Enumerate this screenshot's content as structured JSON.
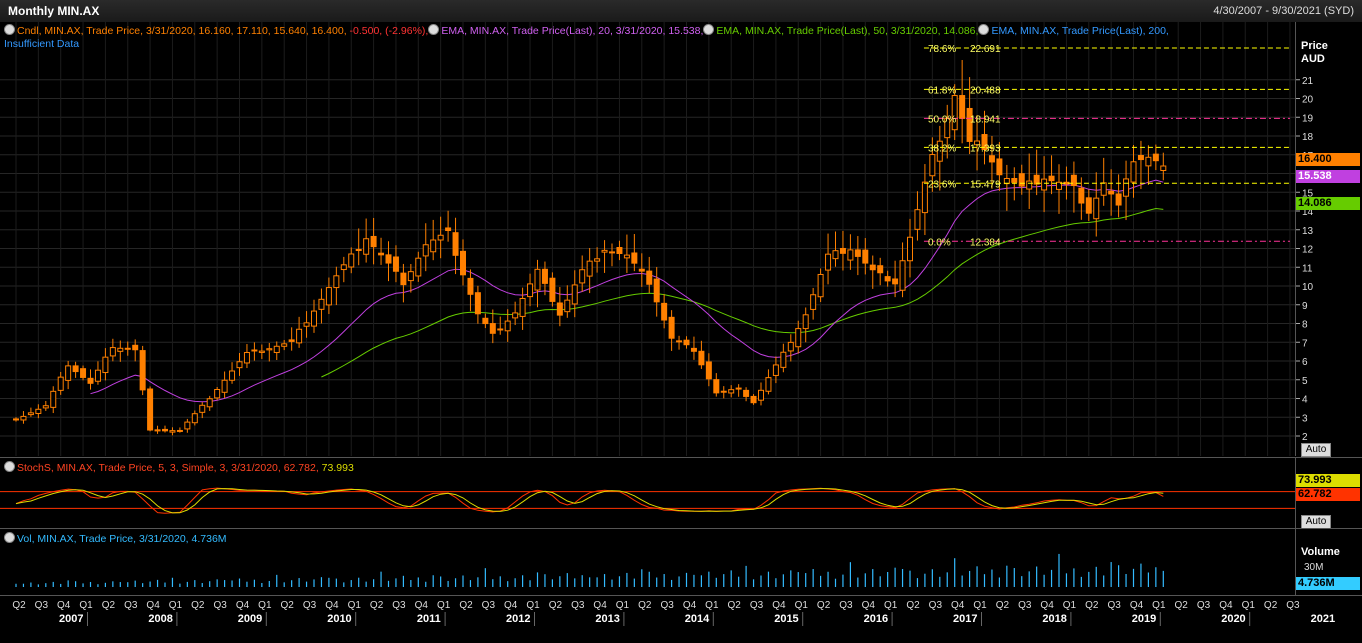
{
  "window": {
    "title": "Monthly MIN.AX",
    "date_range": "4/30/2007 - 9/30/2021 (SYD)"
  },
  "legend": {
    "candle_text": "Cndl, MIN.AX, Trade Price,  3/31/2020, 16.160,  17.110,  15.640,  16.400, ",
    "candle_change": "-0.500,  (-2.96%),",
    "ema20_text": "EMA, MIN.AX, Trade Price(Last),  20,  3/31/2020, 15.538,",
    "ema50_text": "EMA, MIN.AX, Trade Price(Last),  50,  3/31/2020, 14.086,",
    "ema200_text": "EMA, MIN.AX, Trade Price(Last),  200,",
    "ema200_text2": "Insufficient Data",
    "stoch_text": "StochS, MIN.AX, Trade Price,  5,  3,  Simple,  3,  3/31/2020, 62.782, ",
    "stoch_d": "73.993",
    "vol_text": "Vol, MIN.AX, Trade Price,  3/31/2020, 4.736M"
  },
  "price_axis": {
    "header1": "Price",
    "header2": "AUD",
    "last_price": "16.400",
    "ema20_value": "15.538",
    "ema50_value": "14.086",
    "auto_label": "Auto"
  },
  "stoch_axis": {
    "k_value": "62.782",
    "d_value": "73.993",
    "auto_label": "Auto"
  },
  "volume_axis": {
    "header": "Volume",
    "tick": "30M",
    "value": "4.736M"
  },
  "colors": {
    "candle": "#ff8000",
    "ema20": "#c040e0",
    "ema50": "#66cc00",
    "fib_yellow": "#ffff00",
    "fib_pink": "#ff3399",
    "stoch_k": "#ff3300",
    "stoch_d": "#dddd00",
    "volume": "#33bbff"
  },
  "chart_data": [
    {
      "type": "candlestick",
      "title": "Monthly MIN.AX",
      "ylabel": "Price AUD",
      "ylim": [
        1.0,
        23.2
      ],
      "y_ticks": [
        2,
        3,
        4,
        5,
        6,
        7,
        8,
        9,
        10,
        11,
        12,
        13,
        14,
        15,
        16,
        17,
        18,
        19,
        20,
        21
      ],
      "x_quarters": [
        "Q2",
        "Q3",
        "Q4",
        "Q1",
        "Q2",
        "Q3",
        "Q4",
        "Q1",
        "Q2",
        "Q3",
        "Q4",
        "Q1",
        "Q2",
        "Q3",
        "Q4",
        "Q1",
        "Q2",
        "Q3",
        "Q4",
        "Q1",
        "Q2",
        "Q3",
        "Q4",
        "Q1",
        "Q2",
        "Q3",
        "Q4",
        "Q1",
        "Q2",
        "Q3",
        "Q4",
        "Q1",
        "Q2",
        "Q3",
        "Q4",
        "Q1",
        "Q2",
        "Q3",
        "Q4",
        "Q1",
        "Q2",
        "Q3",
        "Q4",
        "Q1",
        "Q2",
        "Q3",
        "Q4",
        "Q1",
        "Q2",
        "Q3",
        "Q4",
        "Q1",
        "Q2",
        "Q3",
        "Q4",
        "Q1",
        "Q2",
        "Q3"
      ],
      "x_years": [
        "2007",
        "2008",
        "2009",
        "2010",
        "2011",
        "2012",
        "2013",
        "2014",
        "2015",
        "2016",
        "2017",
        "2018",
        "2019",
        "2020",
        "2021"
      ],
      "close_anchors": [
        [
          "2007-05",
          2.9
        ],
        [
          "2007-09",
          3.6
        ],
        [
          "2007-12",
          5.8
        ],
        [
          "2008-03",
          4.8
        ],
        [
          "2008-06",
          6.8
        ],
        [
          "2008-09",
          6.6
        ],
        [
          "2008-11",
          2.3
        ],
        [
          "2009-03",
          2.3
        ],
        [
          "2009-06",
          3.6
        ],
        [
          "2009-12",
          6.4
        ],
        [
          "2010-06",
          7.0
        ],
        [
          "2010-12",
          10.5
        ],
        [
          "2011-04",
          12.6
        ],
        [
          "2011-09",
          10.2
        ],
        [
          "2011-12",
          12.2
        ],
        [
          "2012-03",
          12.8
        ],
        [
          "2012-07",
          8.5
        ],
        [
          "2012-09",
          7.4
        ],
        [
          "2012-12",
          8.6
        ],
        [
          "2013-03",
          10.8
        ],
        [
          "2013-06",
          8.5
        ],
        [
          "2013-09",
          10.8
        ],
        [
          "2013-12",
          12.0
        ],
        [
          "2014-03",
          11.6
        ],
        [
          "2014-06",
          10.2
        ],
        [
          "2014-09",
          7.2
        ],
        [
          "2014-12",
          6.6
        ],
        [
          "2015-03",
          4.3
        ],
        [
          "2015-06",
          4.5
        ],
        [
          "2015-08",
          3.8
        ],
        [
          "2015-12",
          6.4
        ],
        [
          "2016-03",
          8.5
        ],
        [
          "2016-06",
          11.6
        ],
        [
          "2016-09",
          12.0
        ],
        [
          "2016-12",
          10.8
        ],
        [
          "2017-03",
          10.2
        ],
        [
          "2017-05",
          12.6
        ],
        [
          "2017-08",
          16.8
        ],
        [
          "2017-11",
          20.2
        ],
        [
          "2018-01",
          17.6
        ],
        [
          "2018-03",
          17.5
        ],
        [
          "2018-05",
          16.0
        ],
        [
          "2018-08",
          15.2
        ],
        [
          "2018-11",
          15.8
        ],
        [
          "2019-03",
          15.2
        ],
        [
          "2019-05",
          14.0
        ],
        [
          "2019-07",
          15.5
        ],
        [
          "2019-09",
          14.2
        ],
        [
          "2019-11",
          16.8
        ],
        [
          "2020-01",
          16.9
        ],
        [
          "2020-03",
          16.4
        ]
      ],
      "last_candle": {
        "date": "3/31/2020",
        "open": 16.16,
        "high": 17.11,
        "low": 15.64,
        "close": 16.4
      },
      "ema20_last": 15.538,
      "ema50_last": 14.086,
      "fibonacci": [
        {
          "label": "78.6%",
          "value": "22.691",
          "level": 22.691
        },
        {
          "label": "61.8%",
          "value": "20.488",
          "level": 20.488
        },
        {
          "label": "50.0%",
          "value": "18.941",
          "level": 18.941
        },
        {
          "label": "38.2%",
          "value": "17.393",
          "level": 17.393
        },
        {
          "label": "23.6%",
          "value": "15.479",
          "level": 15.479
        },
        {
          "label": "0.0%",
          "value": "12.384",
          "level": 12.384
        }
      ]
    },
    {
      "type": "line",
      "title": "StochS",
      "ylim": [
        0,
        100
      ],
      "overbought": 80,
      "oversold": 20,
      "k_last": 62.782,
      "d_last": 73.993
    },
    {
      "type": "bar",
      "title": "Vol",
      "ylabel": "Volume",
      "last_volume": "4.736M"
    }
  ]
}
